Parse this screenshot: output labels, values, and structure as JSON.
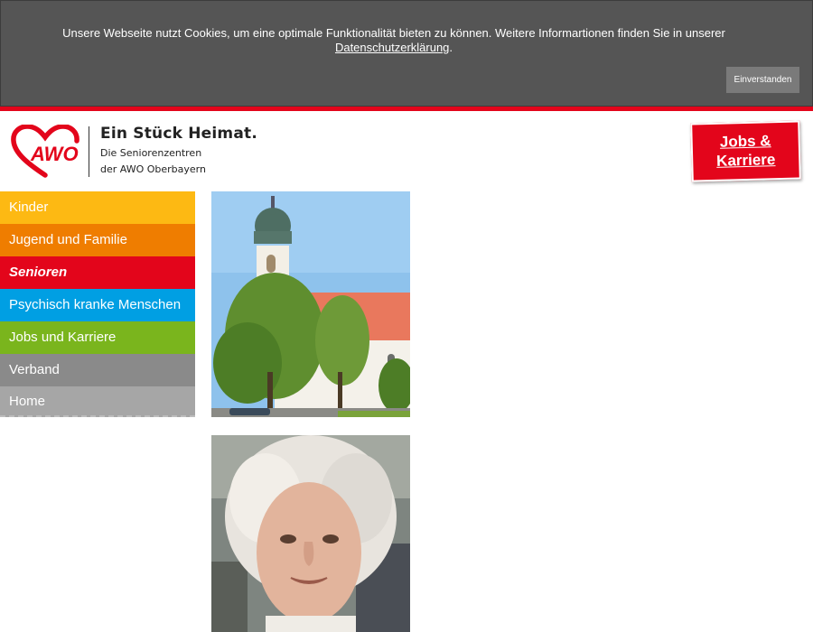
{
  "cookie_banner": {
    "text": "Unsere Webseite nutzt Cookies, um eine optimale Funktionalität bieten zu können. Weitere Informartionen finden Sie in unserer",
    "link": "Datenschutzerklärung",
    "link_suffix": ".",
    "accept_button": "Einverstanden"
  },
  "header": {
    "logo_text": "AWO",
    "tagline_title": "Ein Stück Heimat.",
    "tagline_line1": "Die Seniorenzentren",
    "tagline_line2": "der AWO Oberbayern",
    "jobs_button_line1": "Jobs &",
    "jobs_button_line2": "Karriere"
  },
  "nav": {
    "items": [
      {
        "label": "Kinder",
        "color": "#fdb913"
      },
      {
        "label": "Jugend und Familie",
        "color": "#ef7d00"
      },
      {
        "label": "Senioren",
        "color": "#e3051b"
      },
      {
        "label": "Psychisch kranke Menschen",
        "color": "#009fe3"
      },
      {
        "label": "Jobs und Karriere",
        "color": "#7ab51d"
      },
      {
        "label": "Verband",
        "color": "#8a8a8a"
      },
      {
        "label": "Home",
        "color": "#a6a6a6"
      }
    ]
  },
  "colors": {
    "brand_red": "#e3051b",
    "banner_bg": "#555555"
  },
  "images": {
    "church": "church-photo",
    "woman": "senior-woman-photo"
  }
}
